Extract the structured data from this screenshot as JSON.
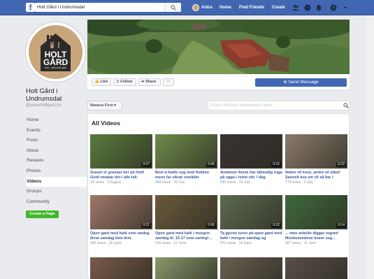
{
  "topbar": {
    "logo": "f",
    "search_value": "Holt Gård i Undrumsdal",
    "user_name": "Antra",
    "home": "Home",
    "find_friends": "Find Friends",
    "create": "Create"
  },
  "sidebar": {
    "logo_text_1": "HOLT",
    "logo_text_2": "GÅRD",
    "logo_sub": "MAT · OPPLEVELSER",
    "page_name": "Holt Gård i Undrumsdal",
    "handle": "@www.holtgard.no",
    "items": [
      {
        "label": "Home"
      },
      {
        "label": "Events"
      },
      {
        "label": "Posts"
      },
      {
        "label": "About"
      },
      {
        "label": "Reviews"
      },
      {
        "label": "Photos"
      },
      {
        "label": "Videos"
      },
      {
        "label": "Groups"
      },
      {
        "label": "Community"
      }
    ],
    "create_page": "Create a Page"
  },
  "actions": {
    "like": "Like",
    "follow": "Follow",
    "share": "Share",
    "more": "···",
    "send_message": "Send Message"
  },
  "filter": {
    "sort_label": "Newest First ▾",
    "search_placeholder": "Search Holt Gård i Undrumsdal's videos"
  },
  "videos": {
    "title": "All Videos",
    "items": [
      {
        "title": "Graset er granast her på Holt! Godt smakar det i alle fall.",
        "meta": "1K views · 3 August",
        "duration": "0:37",
        "color": "#5a7a3c"
      },
      {
        "title": "Best å halde seg med flokken mens far sikrar området",
        "meta": "548 views · 30 July",
        "duration": "0:45",
        "color": "#6e8a4a"
      },
      {
        "title": "Andemor Annie har tålmodig ruga på egga i reiret sitt. I dag",
        "meta": "644 views · 15 July",
        "duration": "0:22",
        "color": "#3a3330"
      },
      {
        "title": "Nokre vil kose, andre vil släst! Sannelt kva vin vil så har i",
        "meta": "779 views · 2 July",
        "duration": "0:22",
        "color": "#8a7a6a"
      },
      {
        "title": "Open gard med kafé som vanleg (kvar søndag hele året,",
        "meta": "956 views · 30 June",
        "duration": "0:21",
        "color": "#a07868"
      },
      {
        "title": "Open gard med kafé i morgon søndag kl. 13-17 som vanleg!...",
        "meta": "416 views · 22 June",
        "duration": "0:06",
        "color": "#6a5a3a"
      },
      {
        "title": "Ta gjerne turen på open gard med kafé i morgon søndag og",
        "meta": "870 views · 16 June",
        "duration": "0:22",
        "color": "#5e6a50"
      },
      {
        "title": "... men enkelte diggar regnet! Moskusendene koser seg...",
        "meta": "607 views · 11 June",
        "duration": "0:14",
        "color": "#3f6a3a"
      },
      {
        "title": "",
        "meta": "",
        "duration": "",
        "color": "#7a5a4a"
      },
      {
        "title": "",
        "meta": "",
        "duration": "",
        "color": "#8a9a6a"
      },
      {
        "title": "",
        "meta": "",
        "duration": "",
        "color": "#6a6050"
      },
      {
        "title": "",
        "meta": "",
        "duration": "",
        "color": "#5a5048"
      }
    ]
  }
}
